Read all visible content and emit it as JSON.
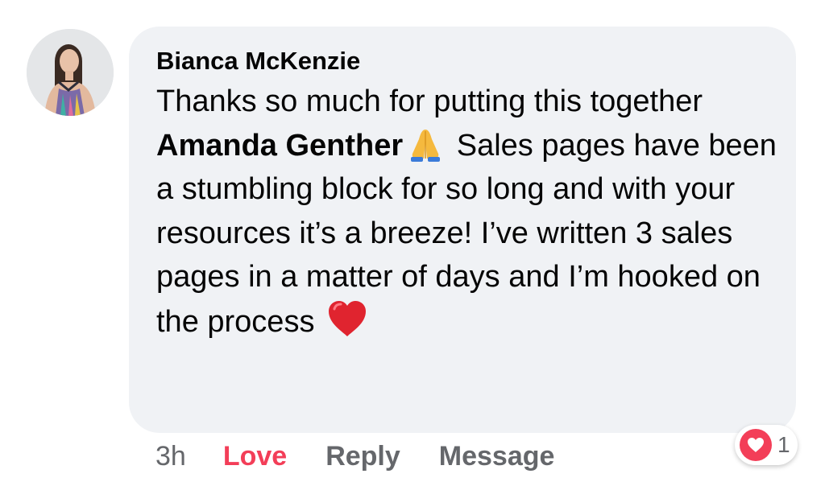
{
  "comment": {
    "author": "Bianca McKenzie",
    "text_before_mention": "Thanks so much for putting this together ",
    "mention": "Amanda Genther",
    "text_after_mention": "Sales pages have been a stumbling block for so long and with your resources it’s a breeze! I’ve written 3 sales pages in a matter of days and I’m hooked on the process",
    "emoji_after_mention": "folded-hands-icon",
    "emoji_end": "red-heart-icon"
  },
  "actions": {
    "time": "3h",
    "love_label": "Love",
    "reply_label": "Reply",
    "message_label": "Message"
  },
  "reactions": {
    "icon": "heart-icon",
    "count": "1"
  },
  "colors": {
    "bubble": "#f0f2f5",
    "love": "#f33e58",
    "meta": "#65676b",
    "text": "#050505"
  }
}
